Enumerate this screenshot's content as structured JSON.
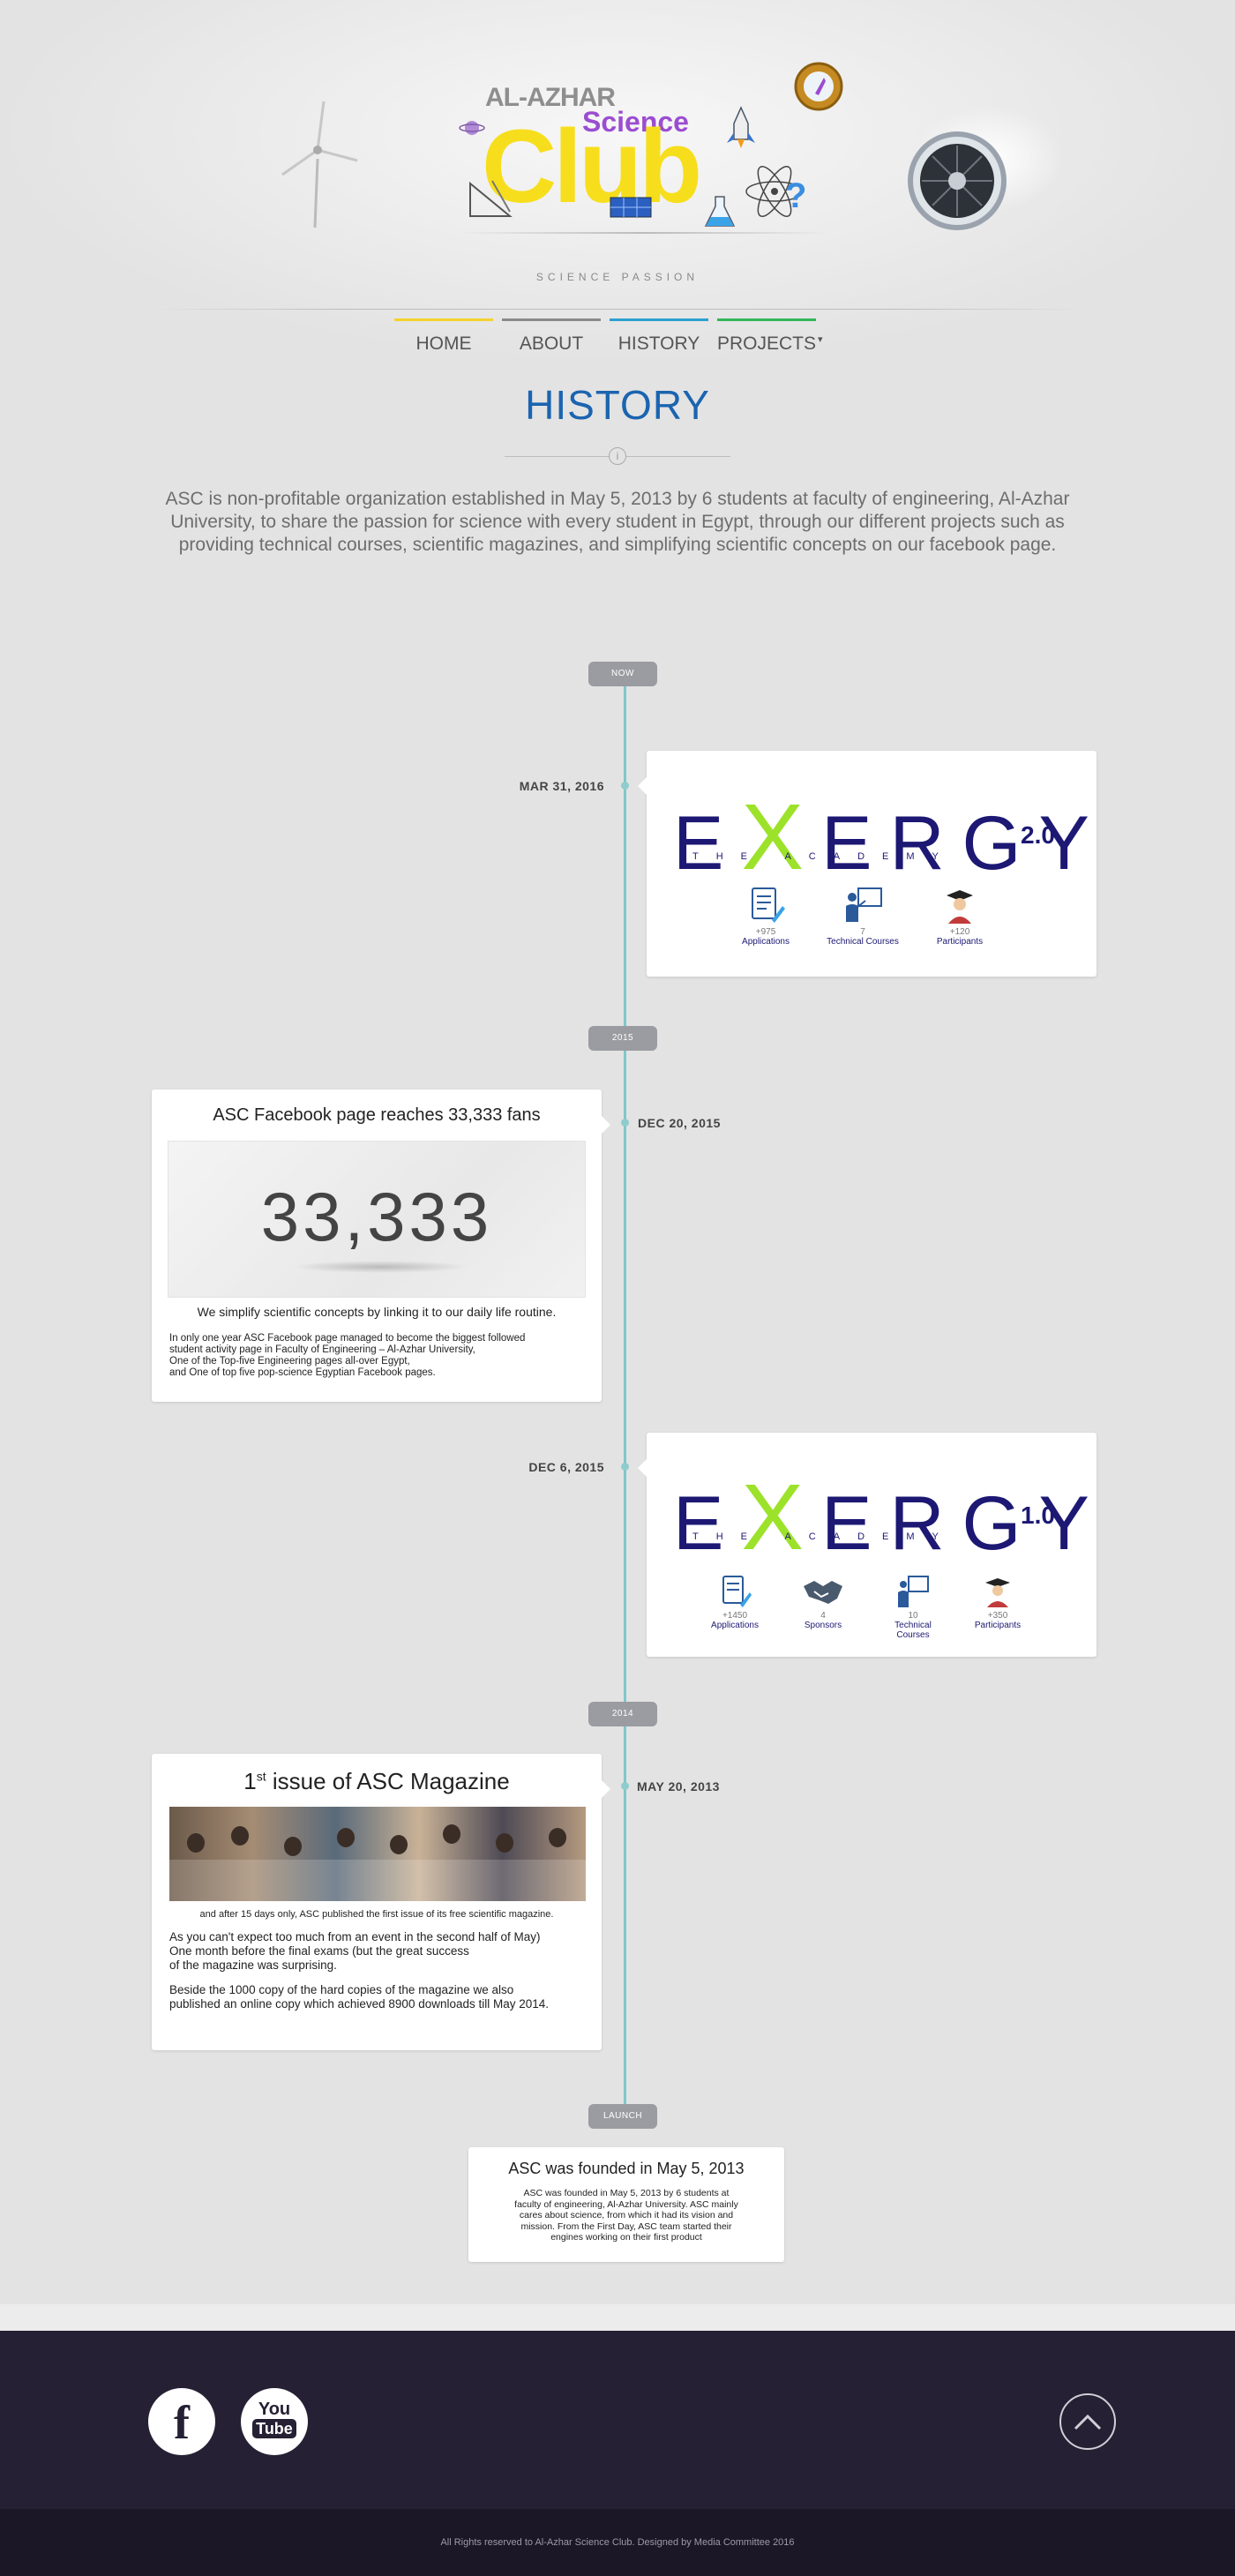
{
  "header": {
    "logo_line1": "AL-AZHAR",
    "logo_line2": "Science",
    "logo_line3": "Club",
    "tagline": "SCIENCE PASSION"
  },
  "nav": {
    "items": [
      {
        "label": "HOME",
        "color": "#f4d22c"
      },
      {
        "label": "ABOUT",
        "color": "#8a8a8a"
      },
      {
        "label": "HISTORY",
        "color": "#2c9fd1"
      },
      {
        "label": "PROJECTS",
        "color": "#33b558",
        "caret": "▾"
      }
    ]
  },
  "history": {
    "title": "HISTORY",
    "intro": "ASC is non-profitable organization established in May 5, 2013 by 6 students at faculty of engineering, Al-Azhar University, to share the passion for science with every student in Egypt, through our different projects such as providing technical courses, scientific magazines, and simplifying scientific concepts on our facebook page."
  },
  "timeline": {
    "pill_now": "NOW",
    "pill_2015": "2015",
    "pill_2014": "2014",
    "pill_launch": "LAUNCH",
    "e1": {
      "date": "MAR 31, 2016",
      "brand_pre": "E",
      "brand_x": "X",
      "brand_post": "ERGY",
      "version": "2.0",
      "academy": "THE ACADEMY",
      "stats": [
        {
          "num": "+975",
          "label": "Applications"
        },
        {
          "num": "7",
          "label": "Technical Courses"
        },
        {
          "num": "+120",
          "label": "Participants"
        }
      ]
    },
    "e2": {
      "date": "DEC 20, 2015",
      "title": "ASC Facebook page reaches 33,333 fans",
      "image_number": "33,333",
      "subtitle": "We simplify scientific concepts by linking it to our daily life routine.",
      "lines": [
        "In only one year ASC Facebook page managed to become the biggest followed",
        "student activity page in Faculty of Engineering – Al-Azhar University,",
        "One of the Top-five Engineering pages all-over Egypt,",
        "and One of top five pop-science Egyptian Facebook pages."
      ]
    },
    "e3": {
      "date": "DEC 6, 2015",
      "brand_pre": "E",
      "brand_x": "X",
      "brand_post": "ERGY",
      "version": "1.0",
      "academy": "THE ACADEMY",
      "stats": [
        {
          "num": "+1450",
          "label": "Applications"
        },
        {
          "num": "4",
          "label": "Sponsors"
        },
        {
          "num": "10",
          "label": "Technical Courses"
        },
        {
          "num": "+350",
          "label": "Participants"
        }
      ]
    },
    "e4": {
      "date": "MAY 20, 2013",
      "title_main": "1",
      "title_sup": "st",
      "title_rest": " issue of ASC Magazine",
      "caption": "and after 15 days only, ASC published the first issue of its free scientific magazine.",
      "para1": [
        "As you can't expect too much from an event in the second half of May)",
        "One month before the final exams (but the great success",
        "of the magazine was surprising."
      ],
      "para2": [
        "Beside the 1000 copy of the hard copies of the magazine we also",
        "published an online copy which achieved 8900 downloads till May 2014."
      ]
    },
    "e5": {
      "title": "ASC was founded in May 5, 2013",
      "lines": [
        "ASC was founded in May 5, 2013 by 6 students at",
        "faculty of engineering, Al-Azhar University. ASC mainly",
        "cares about science, from which it had its vision and",
        "mission. From the First Day, ASC team started their",
        "engines working on their first product"
      ]
    }
  },
  "footer": {
    "facebook_glyph": "f",
    "youtube_top": "You",
    "youtube_bottom": "Tube",
    "copyright": "All Rights reserved to Al-Azhar Science Club. Designed by Media Committee 2016"
  }
}
